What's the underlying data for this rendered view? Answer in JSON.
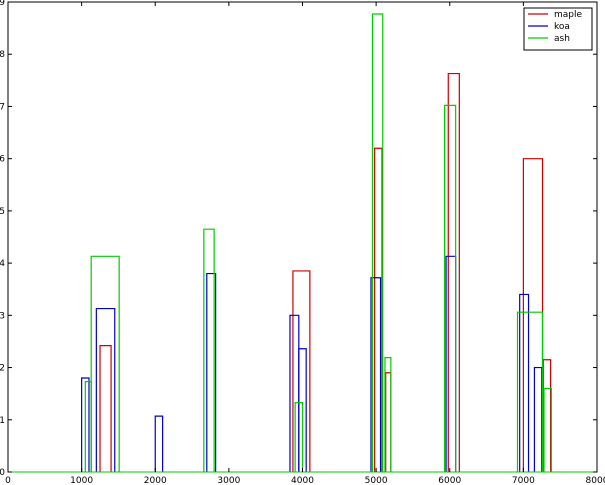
{
  "chart_data": {
    "type": "bar",
    "title": "",
    "xlabel": "",
    "ylabel": "",
    "xlim": [
      0,
      8000
    ],
    "ylim": [
      0,
      9
    ],
    "xticks": [
      0,
      1000,
      2000,
      3000,
      4000,
      5000,
      6000,
      7000,
      8000
    ],
    "xtick_labels": [
      "0",
      "1000",
      "2000",
      "3000",
      "4000",
      "5000",
      "6000",
      "7000",
      "8000"
    ],
    "yticks": [
      0,
      1,
      2,
      3,
      4,
      5,
      6,
      7,
      8,
      9
    ],
    "ytick_labels": [
      "0",
      "1",
      "2",
      "3",
      "4",
      "5",
      "6",
      "7",
      "8",
      "9"
    ],
    "grid": false,
    "legend_position": "top-right",
    "series": [
      {
        "name": "maple",
        "color": "#cc0000",
        "bars": [
          {
            "x0": 1250,
            "x1": 1400,
            "y": 2.42
          },
          {
            "x0": 3870,
            "x1": 4100,
            "y": 3.85
          },
          {
            "x0": 4980,
            "x1": 5080,
            "y": 6.2
          },
          {
            "x0": 5130,
            "x1": 5200,
            "y": 1.9
          },
          {
            "x0": 5980,
            "x1": 6130,
            "y": 7.63
          },
          {
            "x0": 7000,
            "x1": 7260,
            "y": 6.0
          },
          {
            "x0": 7270,
            "x1": 7370,
            "y": 2.15
          }
        ]
      },
      {
        "name": "koa",
        "color": "#0000cc",
        "bars": [
          {
            "x0": 1000,
            "x1": 1100,
            "y": 1.8
          },
          {
            "x0": 1200,
            "x1": 1450,
            "y": 3.13
          },
          {
            "x0": 2000,
            "x1": 2100,
            "y": 1.07
          },
          {
            "x0": 2700,
            "x1": 2820,
            "y": 3.8
          },
          {
            "x0": 3830,
            "x1": 3950,
            "y": 3.0
          },
          {
            "x0": 3950,
            "x1": 4050,
            "y": 2.36
          },
          {
            "x0": 4930,
            "x1": 5060,
            "y": 3.72
          },
          {
            "x0": 5950,
            "x1": 6080,
            "y": 4.13
          },
          {
            "x0": 6950,
            "x1": 7070,
            "y": 3.4
          },
          {
            "x0": 7150,
            "x1": 7250,
            "y": 2.0
          }
        ]
      },
      {
        "name": "ash",
        "color": "#00cc00",
        "bars": [
          {
            "x0": 1050,
            "x1": 1130,
            "y": 1.73
          },
          {
            "x0": 1130,
            "x1": 1510,
            "y": 4.13
          },
          {
            "x0": 2660,
            "x1": 2800,
            "y": 4.65
          },
          {
            "x0": 3900,
            "x1": 4000,
            "y": 1.33
          },
          {
            "x0": 4950,
            "x1": 5090,
            "y": 8.77
          },
          {
            "x0": 5120,
            "x1": 5200,
            "y": 2.19
          },
          {
            "x0": 5930,
            "x1": 6080,
            "y": 7.02
          },
          {
            "x0": 6920,
            "x1": 7260,
            "y": 3.06
          },
          {
            "x0": 7280,
            "x1": 7380,
            "y": 1.6
          }
        ]
      }
    ]
  }
}
